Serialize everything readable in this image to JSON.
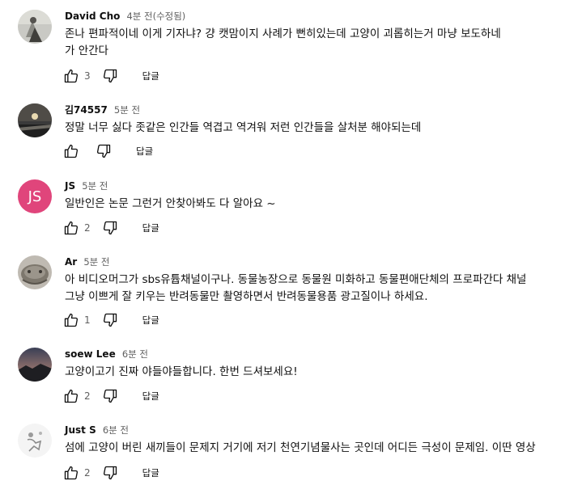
{
  "comments": [
    {
      "author": "David Cho",
      "time": "4분 전(수정됨)",
      "lines": [
        "존나 편파적이네 이게 기자냐? 걍 캣맘이지 사례가 뻔히있는데 고양이 괴롭히는거 마냥 보도하네",
        "가 안간다"
      ],
      "likes": "3",
      "reply": "답글"
    },
    {
      "author": "김74557",
      "time": "5분 전",
      "lines": [
        "정말 너무 싫다 좃같은 인간들 역겹고 역겨워 저런 인간들을 살처분 해야되는데"
      ],
      "likes": "",
      "reply": "답글"
    },
    {
      "author": "JS",
      "avatar_initials": "JS",
      "time": "5분 전",
      "lines": [
        "일반인은 논문 그런거 안찾아봐도 다 알아요 ~"
      ],
      "likes": "2",
      "reply": "답글"
    },
    {
      "author": "Ar",
      "time": "5분 전",
      "lines": [
        "아 비디오머그가 sbs유튭채널이구나. 동물농장으로 동물원 미화하고 동물편애단체의 프로파간다 채널",
        "그냥 이쁘게 잘 키우는 반려동물만 촬영하면서 반려동물용품 광고질이나 하세요."
      ],
      "likes": "1",
      "reply": "답글"
    },
    {
      "author": "soew Lee",
      "time": "6분 전",
      "lines": [
        "고양이고기 진짜 야들야들합니다. 한번 드셔보세요!"
      ],
      "likes": "2",
      "reply": "답글"
    },
    {
      "author": "Just S",
      "time": "6분 전",
      "lines": [
        "섬에 고양이 버린 새끼들이 문제지 거기에 저기 천연기념물사는 곳인데 어디든 극성이 문제임. 이딴 영상"
      ],
      "likes": "2",
      "reply": "답글"
    }
  ],
  "colors": {
    "js_avatar": "#e0457b",
    "secondary_text": "#606060"
  },
  "icons": {
    "like": "thumb-up-icon",
    "dislike": "thumb-down-icon"
  }
}
